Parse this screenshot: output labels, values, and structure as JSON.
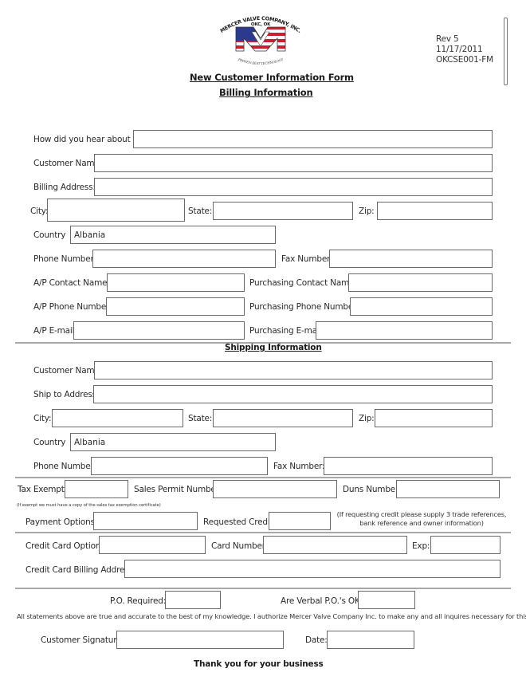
{
  "header": {
    "logo": {
      "company_arc_text": "MERCER VALVE COMPANY, INC.",
      "city_text": "OKC, OK",
      "monogram": "MV",
      "tagline": "PROVEN-SEAT TECHNOLOGY",
      "colors": {
        "red": "#c8202f",
        "blue": "#2b3a8c",
        "white": "#ffffff"
      }
    },
    "form_title": "New Customer Information Form",
    "section_billing": "Billing Information",
    "revision": "Rev 5",
    "date": "11/17/2011",
    "doc_code": "OKCSE001-FM"
  },
  "billing": {
    "hear_about_label": "How did you hear about us:",
    "hear_about_value": "",
    "customer_name_label": "Customer Name:",
    "customer_name_value": "",
    "billing_address_label": "Billing Address:",
    "billing_address_value": "",
    "city_label": "City:",
    "city_value": "",
    "state_label": "State:",
    "state_value": "",
    "zip_label": "Zip:",
    "zip_value": "",
    "country_label": "Country",
    "country_value": "Albania",
    "phone_label": "Phone Number:",
    "phone_value": "",
    "fax_label": "Fax Number:",
    "fax_value": "",
    "ap_contact_label": "A/P Contact Name:",
    "ap_contact_value": "",
    "purchasing_contact_label": "Purchasing Contact Name:",
    "purchasing_contact_value": "",
    "ap_phone_label": "A/P Phone Number:",
    "ap_phone_value": "",
    "purchasing_phone_label": "Purchasing Phone Number:",
    "purchasing_phone_value": "",
    "ap_email_label": "A/P E-mail:",
    "ap_email_value": "",
    "purchasing_email_label": "Purchasing E-mail:",
    "purchasing_email_value": ""
  },
  "shipping": {
    "section_title": "Shipping Information",
    "customer_name_label": "Customer Name:",
    "customer_name_value": "",
    "ship_address_label": "Ship to Address:",
    "ship_address_value": "",
    "city_label": "City:",
    "city_value": "",
    "state_label": "State:",
    "state_value": "",
    "zip_label": "Zip:",
    "zip_value": "",
    "country_label": "Country",
    "country_value": "Albania",
    "phone_label": "Phone Number:",
    "phone_value": "",
    "fax_label": "Fax Number:",
    "fax_value": ""
  },
  "tax": {
    "tax_exempt_label": "Tax Exempt:",
    "tax_exempt_value": "",
    "sales_permit_label": "Sales Permit Number:",
    "sales_permit_value": "",
    "duns_label": "Duns Number:",
    "duns_value": "",
    "exempt_note": "(If exempt we must have a copy of the sales tax exemption certificate)",
    "payment_options_label": "Payment Options:",
    "payment_options_value": "",
    "requested_credit_label": "Requested Credit:",
    "requested_credit_value": "",
    "credit_note": "(If requesting credit please supply 3 trade references, bank reference and owner information)"
  },
  "credit_card": {
    "options_label": "Credit Card Options:",
    "options_value": "",
    "number_label": "Card Number:",
    "number_value": "",
    "exp_label": "Exp:",
    "exp_value": "",
    "billing_address_label": "Credit Card Billing Address:",
    "billing_address_value": ""
  },
  "footer": {
    "po_required_label": "P.O. Required:",
    "po_required_value": "",
    "verbal_po_label": "Are Verbal P.O.'s OK:",
    "verbal_po_value": "",
    "statement": "All statements above are true and accurate to the best of my knowledge. I authorize Mercer Valve Company Inc. to make any and all inquires necessary for this application.",
    "signature_label": "Customer Signature:",
    "signature_value": "",
    "date_label": "Date:",
    "date_value": "",
    "thank_you": "Thank you for your business"
  }
}
